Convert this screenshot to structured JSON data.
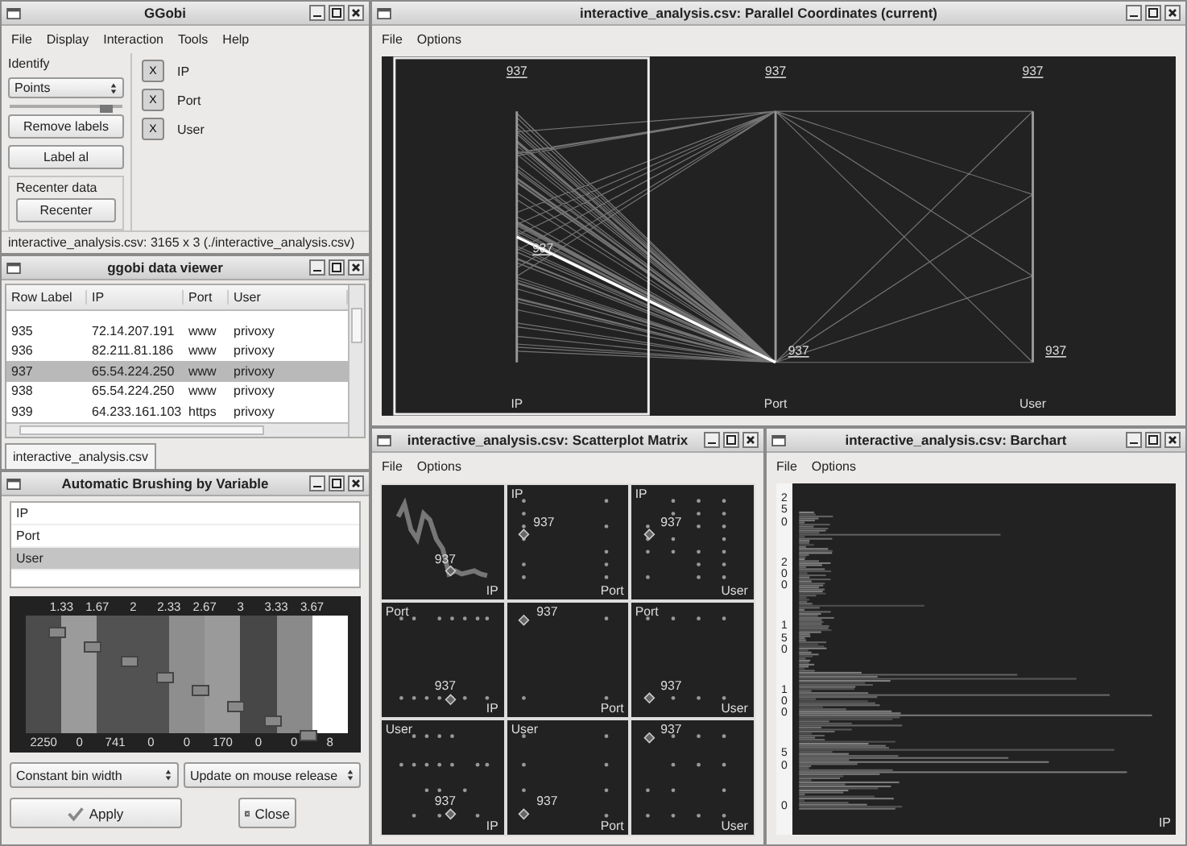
{
  "ggobi": {
    "title": "GGobi",
    "menu": [
      "File",
      "Display",
      "Interaction",
      "Tools",
      "Help"
    ],
    "identify_label": "Identify",
    "mode": "Points",
    "slider": {
      "level": 0.92
    },
    "buttons": [
      "Remove labels",
      "Label al"
    ],
    "recenter_group": "Recenter data",
    "recenter_button": "Recenter",
    "variables": [
      {
        "toggle": "X",
        "name": "IP"
      },
      {
        "toggle": "X",
        "name": "Port"
      },
      {
        "toggle": "X",
        "name": "User"
      }
    ],
    "status": "interactive_analysis.csv: 3165 x 3 (./interactive_analysis.csv)"
  },
  "data_viewer": {
    "title": "ggobi data viewer",
    "columns": [
      "Row Label",
      "IP",
      "Port",
      "User"
    ],
    "rows": [
      {
        "cells": [
          "935",
          "72.14.207.191",
          "www",
          "privoxy"
        ],
        "selected": false
      },
      {
        "cells": [
          "936",
          "82.211.81.186",
          "www",
          "privoxy"
        ],
        "selected": false
      },
      {
        "cells": [
          "937",
          "65.54.224.250",
          "www",
          "privoxy"
        ],
        "selected": true
      },
      {
        "cells": [
          "938",
          "65.54.224.250",
          "www",
          "privoxy"
        ],
        "selected": false
      },
      {
        "cells": [
          "939",
          "64.233.161.103",
          "https",
          "privoxy"
        ],
        "selected": false
      }
    ],
    "tab": "interactive_analysis.csv"
  },
  "brushing": {
    "title": "Automatic Brushing by Variable",
    "variables": [
      {
        "name": "IP",
        "selected": false
      },
      {
        "name": "Port",
        "selected": false
      },
      {
        "name": "User",
        "selected": true
      }
    ],
    "tick_labels": [
      "1.33",
      "1.67",
      "2",
      "2.33",
      "2.67",
      "3",
      "3.33",
      "3.67"
    ],
    "bins": [
      {
        "count": "2250",
        "color": "#4c4c4c"
      },
      {
        "count": "0",
        "color": "#9b9b9b"
      },
      {
        "count": "741",
        "color": "#525252"
      },
      {
        "count": "0",
        "color": "#525252"
      },
      {
        "count": "0",
        "color": "#8e8e8e"
      },
      {
        "count": "170",
        "color": "#9a9a9a"
      },
      {
        "count": "0",
        "color": "#474747"
      },
      {
        "count": "0",
        "color": "#8a8a8a"
      },
      {
        "count": "8",
        "color": "#ffffff"
      }
    ],
    "bin_width_mode": "Constant bin width",
    "update_mode": "Update on mouse release",
    "apply": "Apply",
    "close": "Close"
  },
  "parallel": {
    "title": "interactive_analysis.csv: Parallel Coordinates (current)",
    "menu": [
      "File",
      "Options"
    ],
    "axes": [
      {
        "name": "IP",
        "top_label": "937",
        "point_label": "937"
      },
      {
        "name": "Port",
        "top_label": "937",
        "point_label": "937"
      },
      {
        "name": "User",
        "top_label": "937",
        "point_label": "937"
      }
    ]
  },
  "scatter": {
    "title": "interactive_analysis.csv: Scatterplot Matrix",
    "menu": [
      "File",
      "Options"
    ],
    "rows": [
      {
        "cells": [
          {
            "x_label": "IP",
            "point_label": "937"
          },
          {
            "y_label": "IP",
            "x_label": "Port",
            "point_label": "937"
          },
          {
            "y_label": "IP",
            "x_label": "User",
            "point_label": "937"
          }
        ]
      },
      {
        "cells": [
          {
            "y_label": "Port",
            "x_label": "IP",
            "point_label": "937"
          },
          {
            "x_label": "Port",
            "point_label": "937"
          },
          {
            "y_label": "Port",
            "x_label": "User",
            "point_label": "937"
          }
        ]
      },
      {
        "cells": [
          {
            "y_label": "User",
            "x_label": "IP",
            "point_label": "937"
          },
          {
            "y_label": "User",
            "x_label": "Port",
            "point_label": "937"
          },
          {
            "x_label": "User",
            "point_label": "937"
          }
        ]
      }
    ]
  },
  "barchart": {
    "title": "interactive_analysis.csv: Barchart",
    "menu": [
      "File",
      "Options"
    ],
    "y_ticks": [
      "250",
      "200",
      "150",
      "100",
      "50",
      "0"
    ],
    "x_label": "IP"
  }
}
